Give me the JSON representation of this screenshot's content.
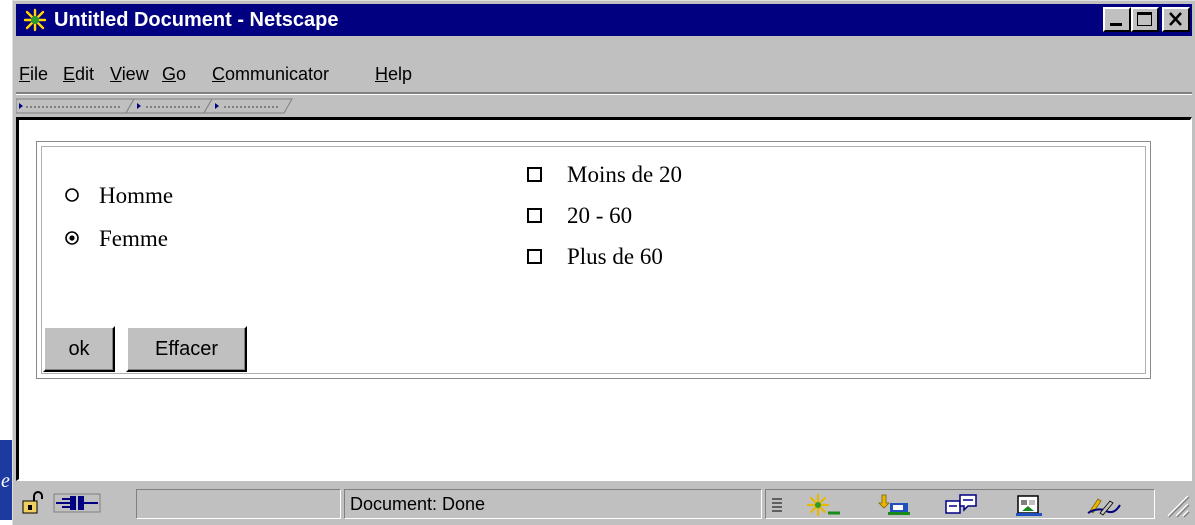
{
  "window": {
    "title": "Untitled Document - Netscape",
    "app_icon": "netscape-icon",
    "controls": [
      "minimize-icon",
      "maximize-icon",
      "close-icon"
    ]
  },
  "edge_tab": {
    "glyph": "e"
  },
  "menu": {
    "file": "File",
    "edit": "Edit",
    "view": "View",
    "go": "Go",
    "communicator": "Communicator",
    "help": "Help"
  },
  "form": {
    "radios": [
      {
        "label": "Homme",
        "checked": false
      },
      {
        "label": "Femme",
        "checked": true
      }
    ],
    "checkboxes": [
      {
        "label": "Moins de 20",
        "checked": false
      },
      {
        "label": "20 - 60",
        "checked": false
      },
      {
        "label": "Plus de 60",
        "checked": false
      }
    ],
    "submit_label": "ok",
    "reset_label": "Effacer"
  },
  "status": {
    "text": "Document: Done",
    "icons": [
      "security-lock-icon",
      "connection-plug-icon",
      "navigator-icon",
      "mail-icon",
      "discussions-icon",
      "composer-icon",
      "sign-icon"
    ]
  },
  "colors": {
    "titlebar": "#000080",
    "chrome": "#c0c0c0",
    "edge_tab": "#1d3aa0"
  }
}
